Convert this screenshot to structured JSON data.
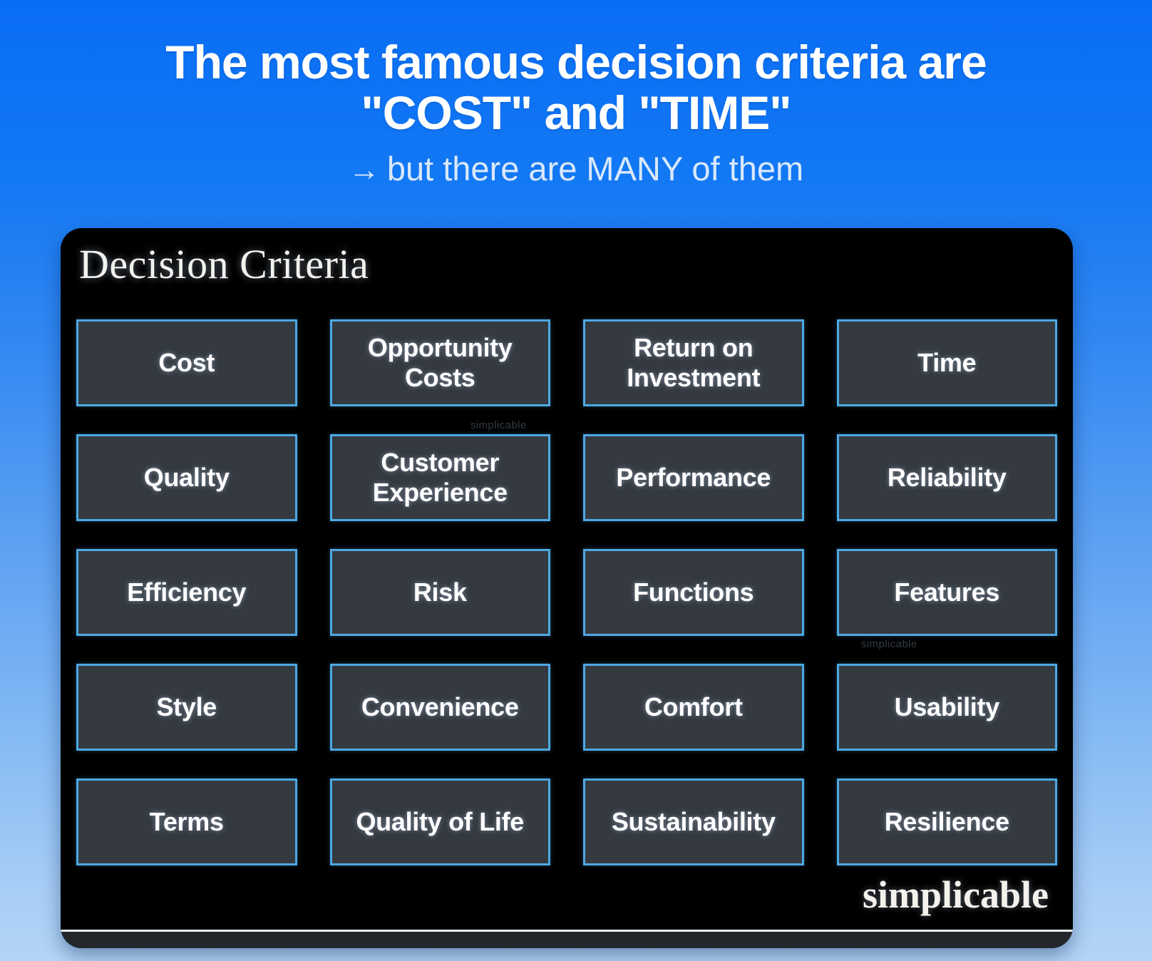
{
  "header": {
    "headline_line1": "The most famous decision criteria are",
    "headline_line2": "\"COST\" and \"TIME\"",
    "subline_arrow": "→",
    "subline_text": "but there are MANY of them"
  },
  "card": {
    "title": "Decision Criteria",
    "brand": "simplicable",
    "watermark": "simplicable",
    "tile_border_color": "#4ea8e3",
    "tile_background_color": "#343a40",
    "card_background_color": "#000000"
  },
  "criteria": [
    {
      "label": "Cost"
    },
    {
      "label": "Opportunity Costs"
    },
    {
      "label": "Return on\nInvestment"
    },
    {
      "label": "Time"
    },
    {
      "label": "Quality"
    },
    {
      "label": "Customer\nExperience"
    },
    {
      "label": "Performance"
    },
    {
      "label": "Reliability"
    },
    {
      "label": "Efficiency"
    },
    {
      "label": "Risk"
    },
    {
      "label": "Functions"
    },
    {
      "label": "Features"
    },
    {
      "label": "Style"
    },
    {
      "label": "Convenience"
    },
    {
      "label": "Comfort"
    },
    {
      "label": "Usability"
    },
    {
      "label": "Terms"
    },
    {
      "label": "Quality of Life"
    },
    {
      "label": "Sustainability"
    },
    {
      "label": "Resilience"
    }
  ],
  "theme": {
    "bg_top": "#0a6df5",
    "bg_bottom": "#b3d4f6",
    "headline_color": "#ffffff",
    "subline_color": "#d9e8fb"
  }
}
